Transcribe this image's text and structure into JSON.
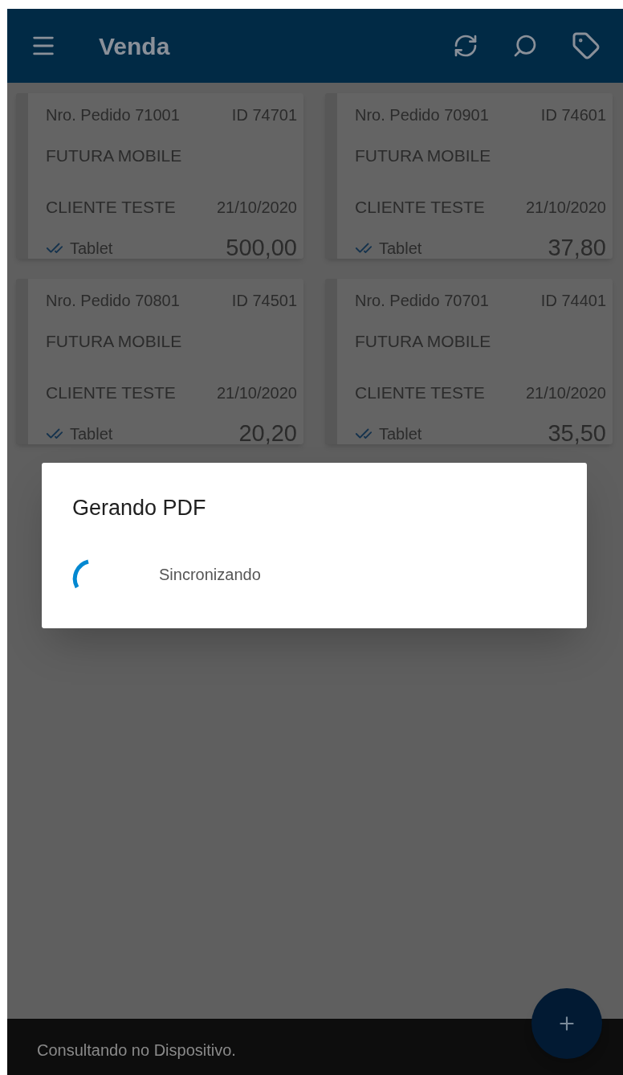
{
  "app_bar": {
    "title": "Venda"
  },
  "orders": [
    {
      "order_number": "Nro. Pedido 71001",
      "id": "ID 74701",
      "company": "FUTURA MOBILE",
      "client": "CLIENTE TESTE",
      "date": "21/10/2020",
      "origin": "Tablet",
      "amount": "500,00"
    },
    {
      "order_number": "Nro. Pedido 70901",
      "id": "ID 74601",
      "company": "FUTURA MOBILE",
      "client": "CLIENTE TESTE",
      "date": "21/10/2020",
      "origin": "Tablet",
      "amount": "37,80"
    },
    {
      "order_number": "Nro. Pedido 70801",
      "id": "ID 74501",
      "company": "FUTURA MOBILE",
      "client": "CLIENTE TESTE",
      "date": "21/10/2020",
      "origin": "Tablet",
      "amount": "20,20"
    },
    {
      "order_number": "Nro. Pedido 70701",
      "id": "ID 74401",
      "company": "FUTURA MOBILE",
      "client": "CLIENTE TESTE",
      "date": "21/10/2020",
      "origin": "Tablet",
      "amount": "35,50"
    }
  ],
  "dialog": {
    "title": "Gerando PDF",
    "message": "Sincronizando"
  },
  "status_bar": {
    "text": "Consultando no Dispositivo."
  }
}
